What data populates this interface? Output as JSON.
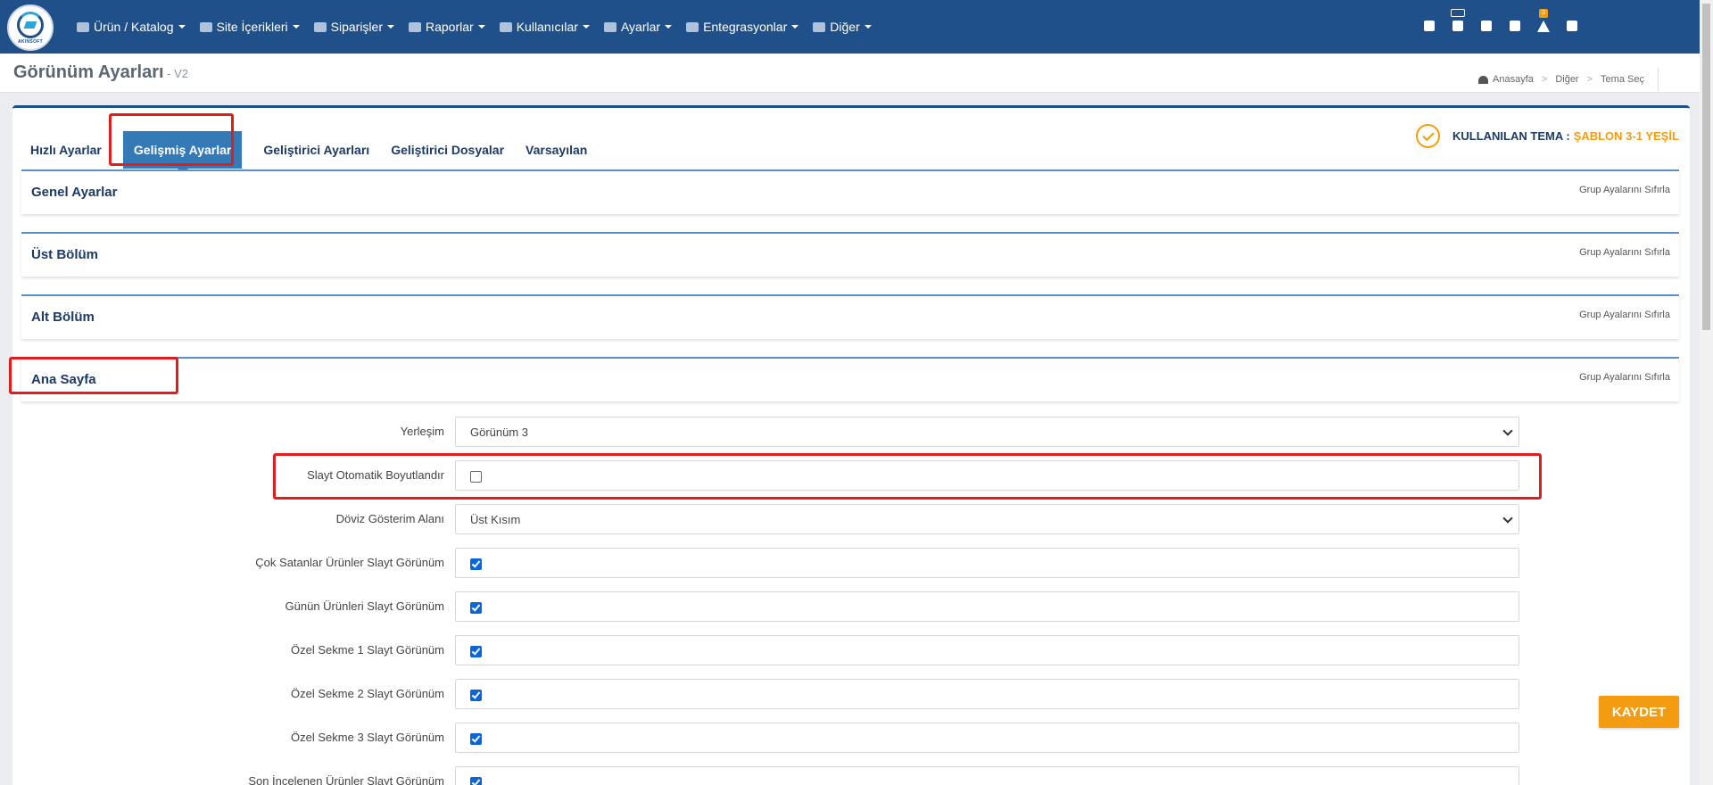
{
  "logo": {
    "text": "AKINSOFT"
  },
  "nav": {
    "items": [
      {
        "label": "Ürün / Katalog",
        "icon": "boxes-icon"
      },
      {
        "label": "Site İçerikleri",
        "icon": "pages-icon"
      },
      {
        "label": "Siparişler",
        "icon": "cart-icon"
      },
      {
        "label": "Raporlar",
        "icon": "report-icon"
      },
      {
        "label": "Kullanıcılar",
        "icon": "users-icon"
      },
      {
        "label": "Ayarlar",
        "icon": "gears-icon"
      },
      {
        "label": "Entegrasyonlar",
        "icon": "network-icon"
      },
      {
        "label": "Diğer",
        "icon": "grid-icon"
      }
    ],
    "alert_badge": "3"
  },
  "page": {
    "title": "Görünüm Ayarları",
    "version": " - V2"
  },
  "breadcrumb": [
    "Anasayfa",
    "Diğer",
    "Tema Seç"
  ],
  "tabs": [
    "Hızlı Ayarlar",
    "Gelişmiş Ayarlar",
    "Geliştirici Ayarları",
    "Geliştirici Dosyalar",
    "Varsayılan"
  ],
  "active_tab": "Gelişmiş Ayarlar",
  "theme": {
    "label": "KULLANILAN TEMA :",
    "value": "ŞABLON 3-1 YEŞİL"
  },
  "sections": [
    {
      "title": "Genel Ayarlar",
      "reset": "Grup Ayalarını Sıfırla"
    },
    {
      "title": "Üst Bölüm",
      "reset": "Grup Ayalarını Sıfırla"
    },
    {
      "title": "Alt Bölüm",
      "reset": "Grup Ayalarını Sıfırla"
    },
    {
      "title": "Ana Sayfa",
      "reset": "Grup Ayalarını Sıfırla"
    }
  ],
  "form": {
    "rows": [
      {
        "label": "Yerleşim",
        "type": "select",
        "value": "Görünüm 3"
      },
      {
        "label": "Slayt Otomatik Boyutlandır",
        "type": "checkbox",
        "checked": false
      },
      {
        "label": "Döviz Gösterim Alanı",
        "type": "select",
        "value": "Üst Kısım"
      },
      {
        "label": "Çok Satanlar Ürünler Slayt Görünüm",
        "type": "checkbox",
        "checked": true
      },
      {
        "label": "Günün Ürünleri Slayt Görünüm",
        "type": "checkbox",
        "checked": true
      },
      {
        "label": "Özel Sekme 1 Slayt Görünüm",
        "type": "checkbox",
        "checked": true
      },
      {
        "label": "Özel Sekme 2 Slayt Görünüm",
        "type": "checkbox",
        "checked": true
      },
      {
        "label": "Özel Sekme 3 Slayt Görünüm",
        "type": "checkbox",
        "checked": true
      },
      {
        "label": "Son İncelenen Ürünler Slayt Görünüm",
        "type": "checkbox",
        "checked": true
      }
    ]
  },
  "save_label": "KAYDET",
  "colors": {
    "navbar": "#20508a",
    "accent": "#f39c12",
    "tab_active": "#337ab7",
    "highlight": "#e01d1d"
  }
}
